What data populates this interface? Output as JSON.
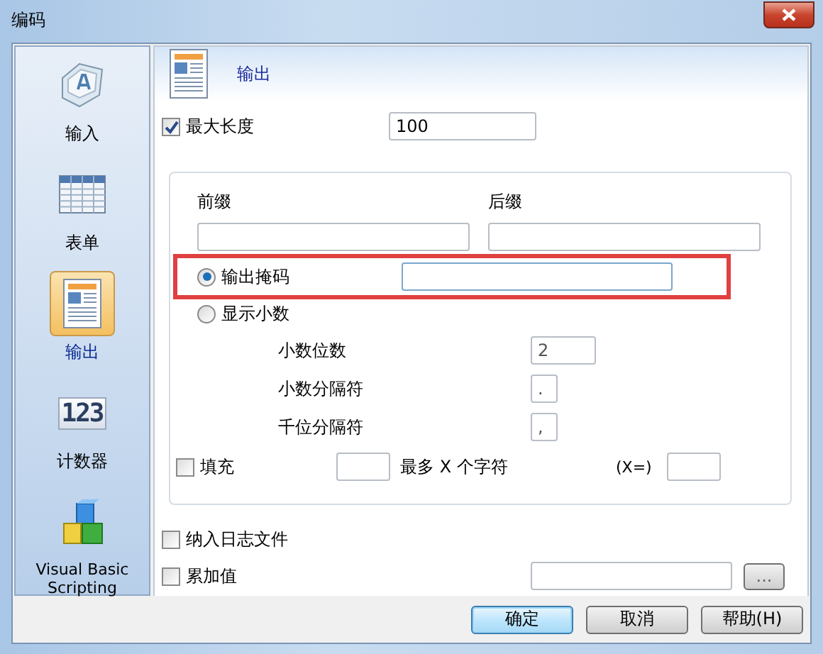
{
  "window": {
    "title": "编码"
  },
  "sidebar": {
    "items": [
      {
        "label": "输入",
        "kind": "key",
        "selected": false
      },
      {
        "label": "表单",
        "kind": "grid",
        "selected": false
      },
      {
        "label": "输出",
        "kind": "document",
        "selected": true
      },
      {
        "label": "计数器",
        "kind": "counter",
        "icon_text": "123",
        "selected": false
      },
      {
        "label": "Visual Basic Scripting",
        "kind": "cubes",
        "selected": false
      }
    ]
  },
  "header": {
    "title": "输出"
  },
  "max_length": {
    "label": "最大长度",
    "checked": true,
    "value": "100"
  },
  "group": {
    "prefix": {
      "label": "前缀"
    },
    "suffix": {
      "label": "后缀"
    },
    "radios": [
      {
        "label": "输出掩码",
        "selected": true,
        "highlighted": true
      },
      {
        "label": "显示小数",
        "selected": false,
        "highlighted": false
      }
    ],
    "decimal_fields": [
      {
        "label": "小数位数",
        "value": "2"
      },
      {
        "label": "小数分隔符",
        "value": "."
      },
      {
        "label": "千位分隔符",
        "value": ","
      }
    ],
    "fill": {
      "label": "填充",
      "checked": false,
      "suffix": "最多 X 个字符",
      "x_label": "(X=)"
    }
  },
  "log_file": {
    "label": "纳入日志文件",
    "checked": false
  },
  "accumulate": {
    "label": "累加值",
    "checked": false,
    "browse": "..."
  },
  "buttons": [
    {
      "label": "确定",
      "default": true
    },
    {
      "label": "取消",
      "default": false
    },
    {
      "label": "帮助(H)",
      "default": false
    }
  ]
}
